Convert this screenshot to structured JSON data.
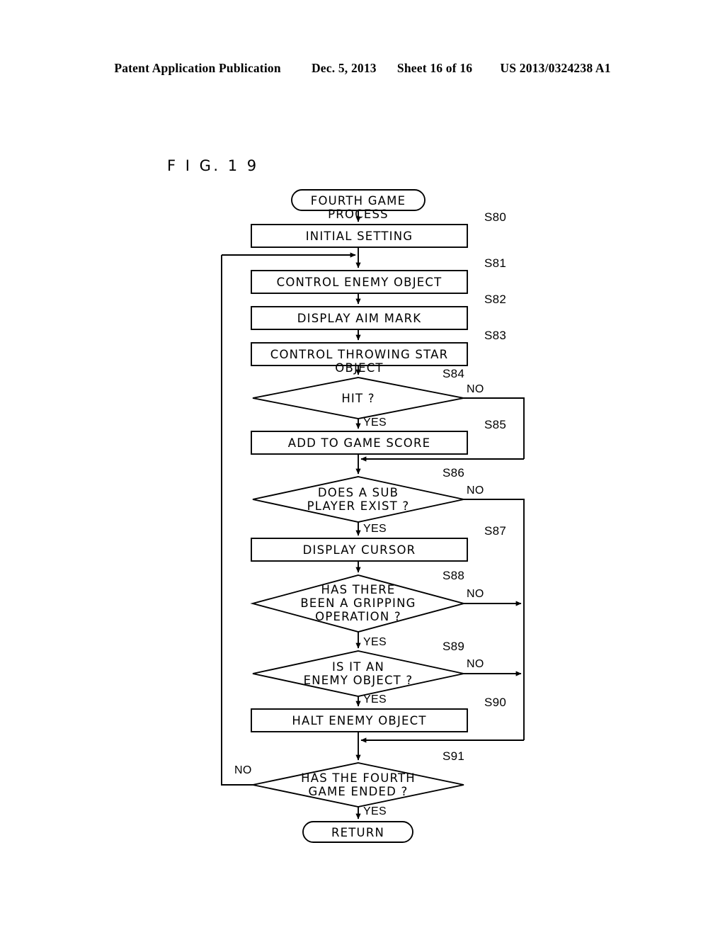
{
  "header": {
    "publication": "Patent Application Publication",
    "date": "Dec. 5, 2013",
    "sheet": "Sheet 16 of 16",
    "patent_number": "US 2013/0324238 A1"
  },
  "figure": {
    "label": "F I G.  1 9"
  },
  "flowchart": {
    "title_node": "FOURTH GAME PROCESS",
    "end_node": "RETURN",
    "nodes": [
      {
        "id": "start",
        "type": "terminator",
        "text": "FOURTH GAME PROCESS",
        "step": ""
      },
      {
        "id": "s80",
        "type": "process",
        "text": "INITIAL SETTING",
        "step": "S80"
      },
      {
        "id": "s81",
        "type": "process",
        "text": "CONTROL ENEMY OBJECT",
        "step": "S81"
      },
      {
        "id": "s82",
        "type": "process",
        "text": "DISPLAY AIM MARK",
        "step": "S82"
      },
      {
        "id": "s83",
        "type": "process",
        "text": "CONTROL THROWING STAR OBJECT",
        "step": "S83"
      },
      {
        "id": "s84",
        "type": "decision",
        "text": "HIT ?",
        "step": "S84"
      },
      {
        "id": "s85",
        "type": "process",
        "text": "ADD TO GAME SCORE",
        "step": "S85"
      },
      {
        "id": "s86",
        "type": "decision",
        "text": "DOES A SUB\nPLAYER EXIST ?",
        "step": "S86"
      },
      {
        "id": "s87",
        "type": "process",
        "text": "DISPLAY CURSOR",
        "step": "S87"
      },
      {
        "id": "s88",
        "type": "decision",
        "text": "HAS THERE\nBEEN A GRIPPING\nOPERATION ?",
        "step": "S88"
      },
      {
        "id": "s89",
        "type": "decision",
        "text": "IS IT AN\nENEMY OBJECT ?",
        "step": "S89"
      },
      {
        "id": "s90",
        "type": "process",
        "text": "HALT ENEMY OBJECT",
        "step": "S90"
      },
      {
        "id": "s91",
        "type": "decision",
        "text": "HAS THE FOURTH\nGAME ENDED ?",
        "step": "S91"
      },
      {
        "id": "return",
        "type": "terminator",
        "text": "RETURN",
        "step": ""
      }
    ],
    "branch_labels": {
      "s84_no": "NO",
      "s84_yes": "YES",
      "s86_no": "NO",
      "s86_yes": "YES",
      "s88_no": "NO",
      "s88_yes": "YES",
      "s89_no": "NO",
      "s89_yes": "YES",
      "s91_no": "NO",
      "s91_yes": "YES"
    },
    "colors": {
      "line": "#000000",
      "background": "#ffffff"
    }
  }
}
